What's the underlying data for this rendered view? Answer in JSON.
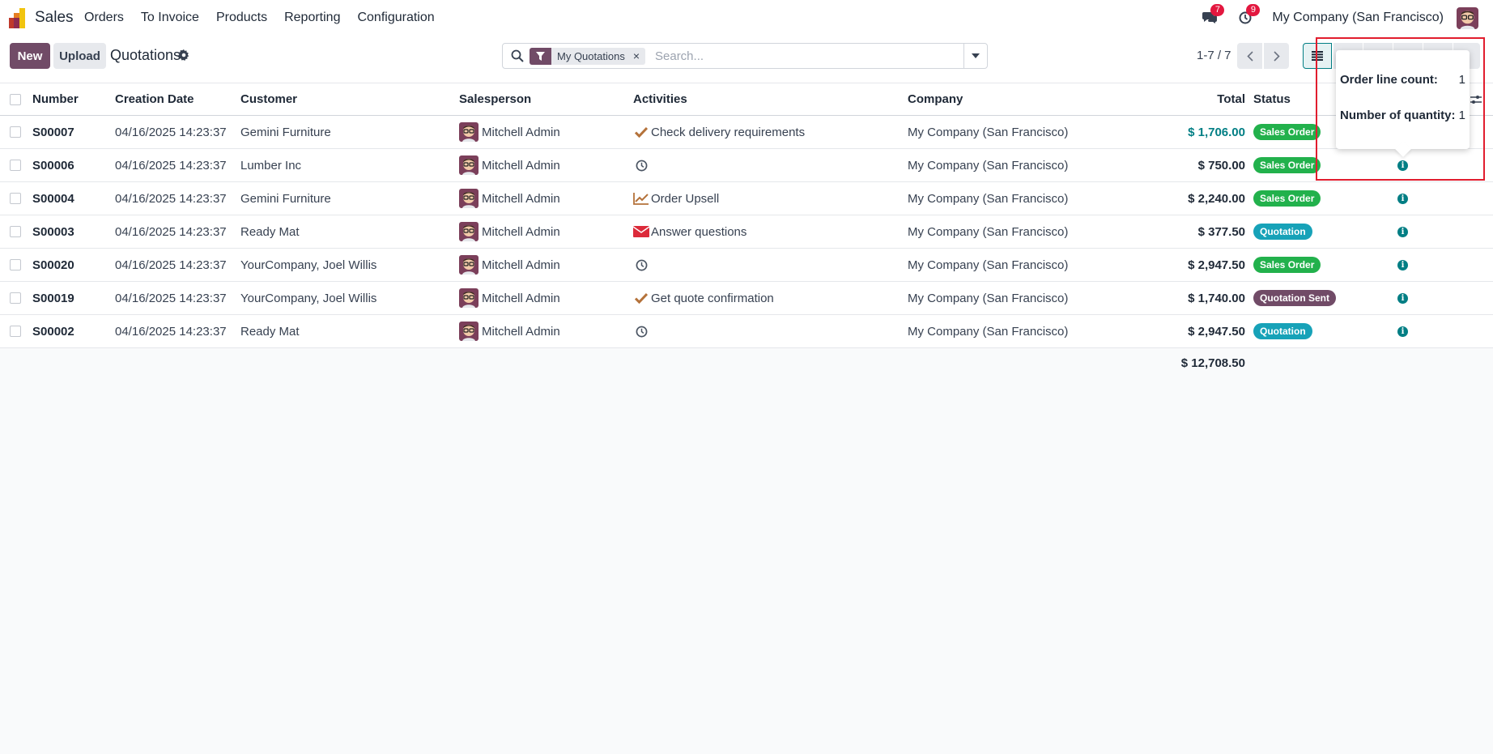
{
  "navbar": {
    "app_name": "Sales",
    "menu": [
      "Orders",
      "To Invoice",
      "Products",
      "Reporting",
      "Configuration"
    ],
    "messages_count": "7",
    "activities_count": "9",
    "company": "My Company (San Francisco)"
  },
  "control_panel": {
    "new_label": "New",
    "upload_label": "Upload",
    "title": "Quotations",
    "search": {
      "facet": "My Quotations",
      "facet_close": "×",
      "placeholder": "Search..."
    },
    "pager": "1-7 / 7"
  },
  "table": {
    "headers": {
      "number": "Number",
      "creation_date": "Creation Date",
      "customer": "Customer",
      "salesperson": "Salesperson",
      "activities": "Activities",
      "company": "Company",
      "total": "Total",
      "status": "Status"
    },
    "rows": [
      {
        "number": "S00007",
        "date": "04/16/2025 14:23:37",
        "customer": "Gemini Furniture",
        "salesperson": "Mitchell Admin",
        "activity_icon": "check-icon",
        "activity": "Check delivery requirements",
        "company": "My Company (San Francisco)",
        "total": "$ 1,706.00",
        "status": "Sales Order"
      },
      {
        "number": "S00006",
        "date": "04/16/2025 14:23:37",
        "customer": "Lumber Inc",
        "salesperson": "Mitchell Admin",
        "activity_icon": "clock-icon",
        "activity": "",
        "company": "My Company (San Francisco)",
        "total": "$ 750.00",
        "status": "Sales Order"
      },
      {
        "number": "S00004",
        "date": "04/16/2025 14:23:37",
        "customer": "Gemini Furniture",
        "salesperson": "Mitchell Admin",
        "activity_icon": "chart-line-icon",
        "activity": "Order Upsell",
        "company": "My Company (San Francisco)",
        "total": "$ 2,240.00",
        "status": "Sales Order"
      },
      {
        "number": "S00003",
        "date": "04/16/2025 14:23:37",
        "customer": "Ready Mat",
        "salesperson": "Mitchell Admin",
        "activity_icon": "envelope-icon",
        "activity": "Answer questions",
        "company": "My Company (San Francisco)",
        "total": "$ 377.50",
        "status": "Quotation"
      },
      {
        "number": "S00020",
        "date": "04/16/2025 14:23:37",
        "customer": "YourCompany, Joel Willis",
        "salesperson": "Mitchell Admin",
        "activity_icon": "clock-icon",
        "activity": "",
        "company": "My Company (San Francisco)",
        "total": "$ 2,947.50",
        "status": "Sales Order"
      },
      {
        "number": "S00019",
        "date": "04/16/2025 14:23:37",
        "customer": "YourCompany, Joel Willis",
        "salesperson": "Mitchell Admin",
        "activity_icon": "check-icon",
        "activity": "Get quote confirmation",
        "company": "My Company (San Francisco)",
        "total": "$ 1,740.00",
        "status": "Quotation Sent"
      },
      {
        "number": "S00002",
        "date": "04/16/2025 14:23:37",
        "customer": "Ready Mat",
        "salesperson": "Mitchell Admin",
        "activity_icon": "clock-icon",
        "activity": "",
        "company": "My Company (San Francisco)",
        "total": "$ 2,947.50",
        "status": "Quotation"
      }
    ],
    "grand_total": "$ 12,708.50"
  },
  "popover": {
    "order_line_count_label": "Order line count:",
    "order_line_count": "1",
    "quantity_label": "Number of quantity:",
    "quantity": "1"
  },
  "colors": {
    "brand": "#714b67",
    "accent": "#017e84",
    "sales_order": "#22b14c",
    "quotation": "#17a2b8",
    "quotation_sent": "#714b67",
    "badge_red": "#e3173f",
    "highlight": "#e11d2e"
  }
}
